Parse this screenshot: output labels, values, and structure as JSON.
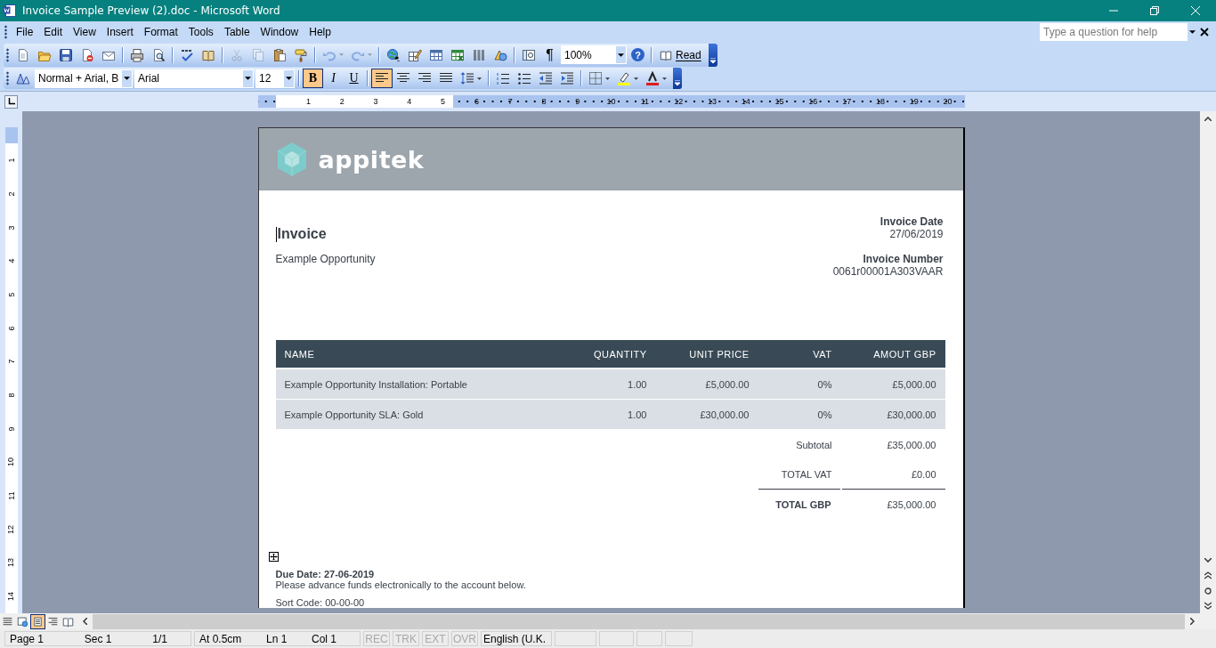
{
  "window": {
    "title": "Invoice Sample Preview (2).doc - Microsoft Word"
  },
  "menu": [
    "File",
    "Edit",
    "View",
    "Insert",
    "Format",
    "Tools",
    "Table",
    "Window",
    "Help"
  ],
  "help_box": {
    "placeholder": "Type a question for help"
  },
  "standard_toolbar": {
    "groups": [
      [
        {
          "kind": "new",
          "disabled": false
        },
        {
          "kind": "open",
          "disabled": false
        },
        {
          "kind": "save",
          "disabled": false
        },
        {
          "kind": "permission",
          "disabled": false
        },
        {
          "kind": "email",
          "disabled": false
        }
      ],
      [
        {
          "kind": "print",
          "disabled": false
        },
        {
          "kind": "preview",
          "disabled": false
        }
      ],
      [
        {
          "kind": "spelling",
          "disabled": false
        },
        {
          "kind": "research",
          "disabled": false
        }
      ],
      [
        {
          "kind": "cut",
          "disabled": true
        },
        {
          "kind": "copy",
          "disabled": true
        },
        {
          "kind": "paste",
          "disabled": false
        },
        {
          "kind": "painter",
          "disabled": false
        }
      ],
      [
        {
          "kind": "undo",
          "disabled": true
        },
        {
          "kind": "redo",
          "disabled": true
        }
      ],
      [
        {
          "kind": "hyperlink",
          "disabled": false
        },
        {
          "kind": "tables_borders",
          "disabled": false
        },
        {
          "kind": "insert_table",
          "disabled": false
        },
        {
          "kind": "insert_excel",
          "disabled": false
        },
        {
          "kind": "columns",
          "disabled": false
        },
        {
          "kind": "drawing",
          "disabled": false
        }
      ],
      [
        {
          "kind": "document_map",
          "disabled": false
        },
        {
          "kind": "marks",
          "label": "¶",
          "disabled": false
        },
        {
          "kind": "zoom",
          "value": "100%",
          "disabled": false
        },
        {
          "kind": "help",
          "label": "?",
          "disabled": false
        }
      ],
      [
        {
          "kind": "read",
          "label": "Read",
          "disabled": false
        }
      ]
    ]
  },
  "formatting_toolbar": {
    "style": "Normal + Arial, B",
    "font": "Arial",
    "size": "12",
    "text_styles": [
      {
        "kind": "bold",
        "label": "B",
        "selected": true
      },
      {
        "kind": "italic",
        "label": "I",
        "selected": false
      },
      {
        "kind": "underline",
        "label": "U",
        "selected": false
      }
    ],
    "alignment": [
      {
        "kind": "left",
        "selected": true
      },
      {
        "kind": "center",
        "selected": false
      },
      {
        "kind": "right",
        "selected": false
      },
      {
        "kind": "justify",
        "selected": false
      }
    ]
  },
  "horizontal_ruler": [
    "1",
    "2",
    "3",
    "4",
    "5",
    "6",
    "7",
    "8",
    "9",
    "10",
    "11",
    "12",
    "13",
    "14",
    "15",
    "16",
    "17",
    "18",
    "19",
    "20"
  ],
  "vertical_ruler": [
    "1",
    "2",
    "3",
    "4",
    "5",
    "6",
    "7",
    "8",
    "9",
    "10",
    "11",
    "12",
    "13",
    "14"
  ],
  "document": {
    "logo": "appitek",
    "title": "Invoice",
    "subtitle": "Example Opportunity",
    "meta": [
      {
        "label": "Invoice Date",
        "value": "27/06/2019"
      },
      {
        "label": "Invoice Number",
        "value": "0061r00001A303VAAR"
      }
    ],
    "table": {
      "columns": [
        "NAME",
        "QUANTITY",
        "UNIT PRICE",
        "VAT",
        "AMOUT GBP"
      ],
      "rows": [
        [
          "Example Opportunity Installation: Portable",
          "1.00",
          "£5,000.00",
          "0%",
          "£5,000.00"
        ],
        [
          "Example Opportunity SLA: Gold",
          "1.00",
          "£30,000.00",
          "0%",
          "£30,000.00"
        ]
      ]
    },
    "totals": [
      {
        "label": "Subtotal",
        "value": "£35,000.00",
        "kind": "normal"
      },
      {
        "label": "TOTAL VAT",
        "value": "£0.00",
        "kind": "normal"
      },
      {
        "label": "TOTAL GBP",
        "value": "£35,000.00",
        "kind": "grand"
      }
    ],
    "due_date": "Due Date: 27-06-2019",
    "instructions": "Please advance funds electronically to the account below.",
    "sort_code": "Sort Code: 00-00-00"
  },
  "views": [
    {
      "kind": "normal",
      "selected": false
    },
    {
      "kind": "web",
      "selected": false
    },
    {
      "kind": "print",
      "selected": true
    },
    {
      "kind": "outline",
      "selected": false
    },
    {
      "kind": "reading",
      "selected": false
    }
  ],
  "status_bar": {
    "groups": [
      [
        "Page 1",
        "Sec 1",
        "1/1"
      ],
      [
        "At 0.5cm",
        "Ln 1",
        "Col 1"
      ]
    ],
    "indicators": [
      {
        "label": "REC",
        "disabled": true
      },
      {
        "label": "TRK",
        "disabled": true
      },
      {
        "label": "EXT",
        "disabled": true
      },
      {
        "label": "OVR",
        "disabled": true
      }
    ],
    "language": "English (U.K."
  }
}
